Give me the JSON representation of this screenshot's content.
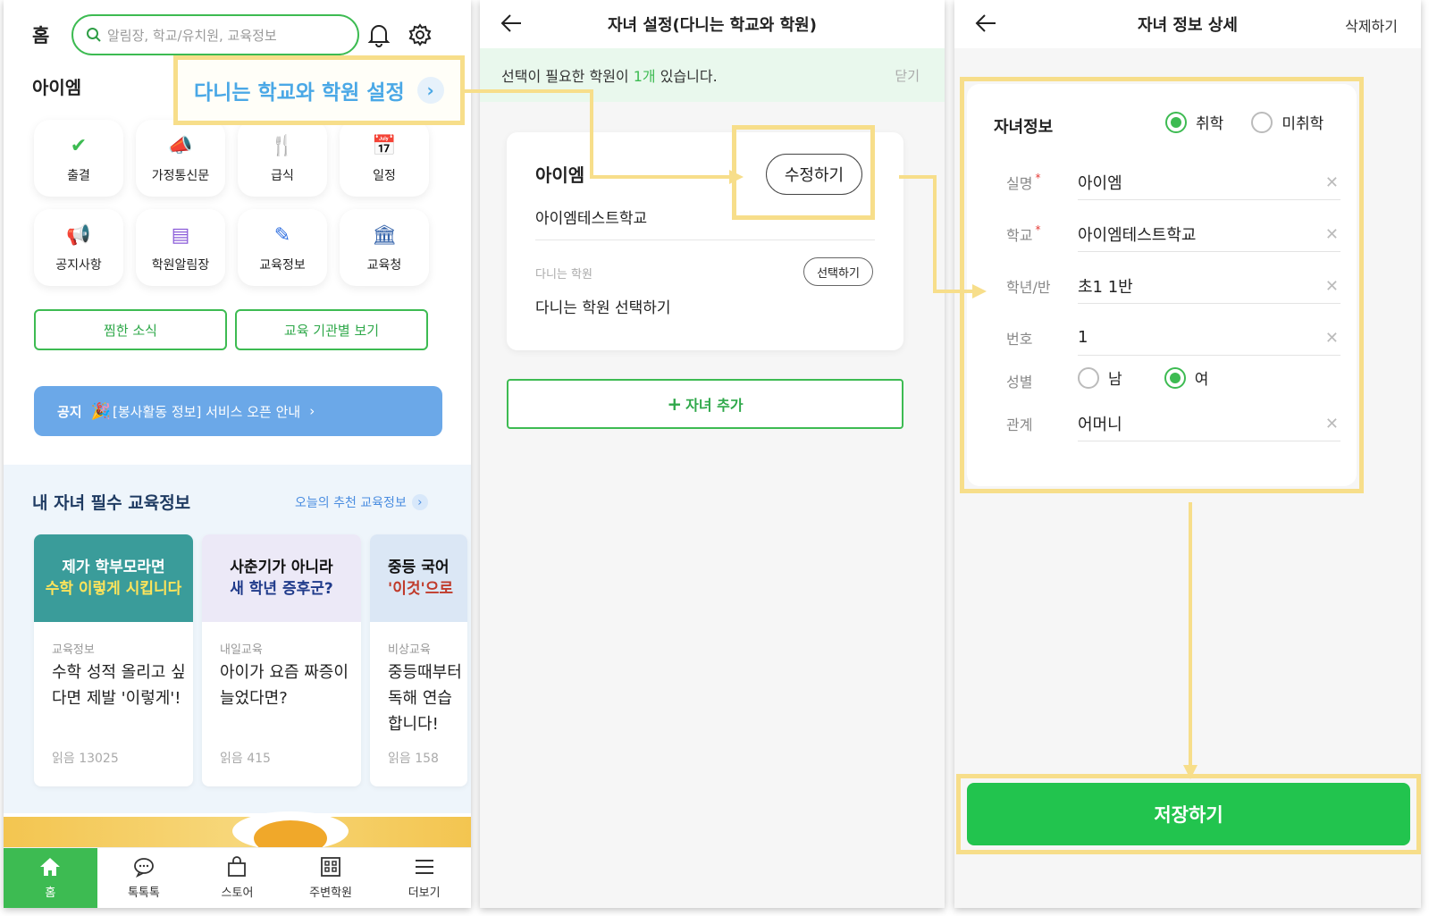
{
  "screen1": {
    "home_label": "홈",
    "search_placeholder": "알림장, 학교/유치원, 교육정보",
    "child_name": "아이엠",
    "callout": "다니는 학교와 학원 설정",
    "tiles": [
      {
        "label": "출결",
        "icon": "attendance-icon",
        "glyph": "✔",
        "color": "#3dbb52"
      },
      {
        "label": "가정통신문",
        "icon": "megaphone-icon",
        "glyph": "📣",
        "color": "#ef5a7a"
      },
      {
        "label": "급식",
        "icon": "meal-icon",
        "glyph": "🍴",
        "color": "#f08b2a"
      },
      {
        "label": "일정",
        "icon": "calendar-icon",
        "glyph": "📅",
        "color": "#f3b632"
      },
      {
        "label": "공지사항",
        "icon": "notice-icon",
        "glyph": "📢",
        "color": "#4ac1e0"
      },
      {
        "label": "학원알림장",
        "icon": "academy-note-icon",
        "glyph": "▤",
        "color": "#8a5bd8"
      },
      {
        "label": "교육정보",
        "icon": "pencil-icon",
        "glyph": "✎",
        "color": "#2f6fe0"
      },
      {
        "label": "교육청",
        "icon": "building-icon",
        "glyph": "🏛",
        "color": "#2f5fa8"
      }
    ],
    "btn_saved_news": "찜한 소식",
    "btn_by_institution": "교육 기관별 보기",
    "notice_tag": "공지",
    "notice_text": "[봉사활동 정보] 서비스 오픈 안내",
    "section_title": "내 자녀 필수 교육정보",
    "section_link": "오늘의 추천 교육정보",
    "cards": [
      {
        "thumb_line1": "제가 학부모라면",
        "thumb_line2": "수학 이렇게 시킵니다",
        "category": "교육정보",
        "title": "수학 성적 올리고 싶다면 제발 '이렇게'!",
        "reads": "읽음 13025"
      },
      {
        "thumb_line1": "사춘기가 아니라",
        "thumb_line2": "새 학년 증후군?",
        "category": "내일교육",
        "title": "아이가 요즘 짜증이 늘었다면?",
        "reads": "읽음 415"
      },
      {
        "thumb_line1": "중등 국어",
        "thumb_line2": "'이것'으로",
        "category": "비상교육",
        "title": "중등때부터 독해 연습합니다!",
        "reads": "읽음 158"
      }
    ],
    "tabs": [
      {
        "label": "홈",
        "icon": "home-icon"
      },
      {
        "label": "톡톡톡",
        "icon": "chat-icon"
      },
      {
        "label": "스토어",
        "icon": "bag-icon"
      },
      {
        "label": "주변학원",
        "icon": "grid-building-icon"
      },
      {
        "label": "더보기",
        "icon": "menu-icon"
      }
    ]
  },
  "screen2": {
    "title": "자녀 설정(다니는 학교와 학원)",
    "alert_prefix": "선택이 필요한 학원이 ",
    "alert_count": "1개",
    "alert_suffix": " 있습니다.",
    "alert_close": "닫기",
    "child_name": "아이엠",
    "edit_button": "수정하기",
    "school_name": "아이엠테스트학교",
    "academy_label": "다니는 학원",
    "select_button": "선택하기",
    "academy_placeholder": "다니는 학원 선택하기",
    "add_child": "자녀 추가"
  },
  "screen3": {
    "title": "자녀 정보 상세",
    "delete": "삭제하기",
    "section_label": "자녀정보",
    "enrolled": "취학",
    "not_enrolled": "미취학",
    "fields": [
      {
        "label": "실명",
        "required": true,
        "value": "아이엠"
      },
      {
        "label": "학교",
        "required": true,
        "value": "아이엠테스트학교"
      },
      {
        "label": "학년/반",
        "required": false,
        "value": "초1 1반"
      },
      {
        "label": "번호",
        "required": false,
        "value": "1"
      }
    ],
    "gender_label": "성별",
    "male": "남",
    "female": "여",
    "relation_label": "관계",
    "relation_value": "어머니",
    "save": "저장하기"
  },
  "colors": {
    "brand_green": "#3dbb52",
    "highlight_yellow": "#f7de8a",
    "notice_blue": "#6ba8e8",
    "link_blue": "#4a8de0"
  }
}
